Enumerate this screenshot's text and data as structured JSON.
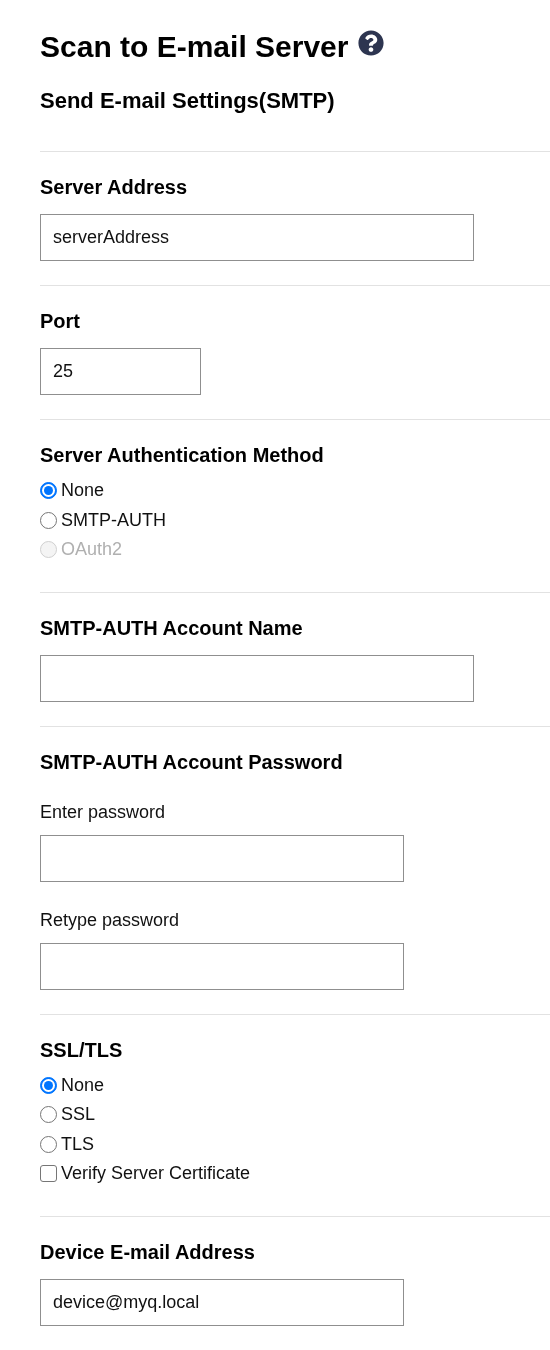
{
  "title": "Scan to E-mail Server",
  "subtitle": "Send E-mail Settings(SMTP)",
  "sections": [
    {
      "kind": "fields",
      "label": "Server Address",
      "fields": [
        {
          "kind": "text",
          "value": "serverAddress"
        }
      ]
    },
    {
      "kind": "fields",
      "label": "Port",
      "fields": [
        {
          "kind": "number",
          "value": "25"
        }
      ]
    },
    {
      "kind": "options",
      "label": "Server Authentication Method",
      "options": [
        {
          "kind": "radio",
          "label": "None",
          "selected": true,
          "disabled": false
        },
        {
          "kind": "radio",
          "label": "SMTP-AUTH",
          "selected": false,
          "disabled": false
        },
        {
          "kind": "radio",
          "label": "OAuth2",
          "selected": false,
          "disabled": true
        }
      ]
    },
    {
      "kind": "fields",
      "label": "SMTP-AUTH Account Name",
      "fields": [
        {
          "kind": "text"
        }
      ]
    },
    {
      "kind": "fields",
      "label": "SMTP-AUTH Account Password",
      "fields": [
        {
          "kind": "password",
          "caption": "Enter password"
        },
        {
          "kind": "password",
          "caption": "Retype password"
        }
      ]
    },
    {
      "kind": "options",
      "label": "SSL/TLS",
      "options": [
        {
          "kind": "radio",
          "label": "None",
          "selected": true,
          "disabled": false
        },
        {
          "kind": "radio",
          "label": "SSL",
          "selected": false,
          "disabled": false
        },
        {
          "kind": "radio",
          "label": "TLS",
          "selected": false,
          "disabled": false
        },
        {
          "kind": "checkbox",
          "label": "Verify Server Certificate",
          "checked": false,
          "disabled": false
        }
      ]
    },
    {
      "kind": "fields",
      "label": "Device E-mail Address",
      "fields": [
        {
          "kind": "email",
          "value": "device@myq.local"
        }
      ]
    }
  ]
}
